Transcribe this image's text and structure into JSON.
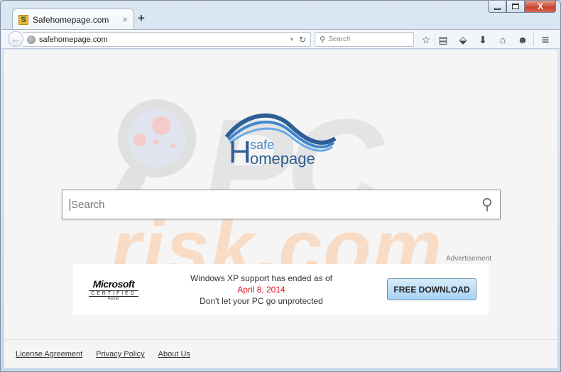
{
  "window": {
    "controls": {
      "minimize": "minimize",
      "maximize": "maximize",
      "close": "X"
    }
  },
  "tabs": [
    {
      "favicon": "S",
      "title": "Safehomepage.com",
      "close": "×"
    }
  ],
  "new_tab": "+",
  "navbar": {
    "back": "←",
    "url": "safehomepage.com",
    "url_dropdown": "▼",
    "reload": "↻",
    "search_placeholder": "Search",
    "search_icon": "🔍",
    "toolbar_icons": [
      "bookmark-star-icon",
      "reading-list-icon",
      "pocket-icon",
      "download-icon",
      "home-icon",
      "chat-icon",
      "menu-icon"
    ],
    "toolbar_glyphs": {
      "star": "☆",
      "list": "▤",
      "pocket": "⬙",
      "download": "⬇",
      "home": "⌂",
      "chat": "☻",
      "menu": "≡"
    }
  },
  "page": {
    "logo": {
      "big_letter": "H",
      "top_word": "safe",
      "bottom_word": "omepage"
    },
    "watermark": {
      "top": "PC",
      "bottom": "risk.com"
    },
    "search": {
      "placeholder": "Search",
      "value": ""
    },
    "ad": {
      "label": "Advertisement",
      "brand": "Microsoft",
      "certified": "CERTIFIED",
      "partner": "Partner",
      "line1": "Windows XP support has ended as of",
      "date": "April 8, 2014",
      "line3": "Don't let your PC go unprotected",
      "button": "FREE DOWNLOAD",
      "date_color": "#d9141e"
    },
    "footer_links": [
      "License Agreement",
      "Privacy Policy",
      "About Us"
    ]
  }
}
